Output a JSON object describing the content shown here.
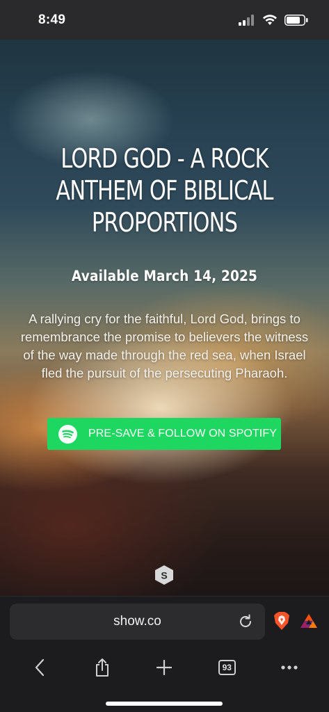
{
  "status_bar": {
    "time": "8:49"
  },
  "hero": {
    "title_lines": [
      "LORD GOD - A ROCK",
      "ANTHEM OF BIBLICAL",
      "PROPORTIONS"
    ],
    "subtitle": "Available March 14, 2025",
    "description": "A rallying cry for the faithful, Lord God, brings to remembrance the promise to believers the witness of the way made through the red sea, when Israel fled the pursuit of the persecuting Pharaoh.",
    "cta_label": "PRE-SAVE & FOLLOW ON SPOTIFY",
    "cta_color": "#1ed760",
    "logo_letter": "S"
  },
  "browser": {
    "url": "show.co",
    "tab_count": "93",
    "toolbar_icons": [
      "back-icon",
      "share-icon",
      "new-tab-icon",
      "tabs-icon",
      "more-icon"
    ]
  }
}
